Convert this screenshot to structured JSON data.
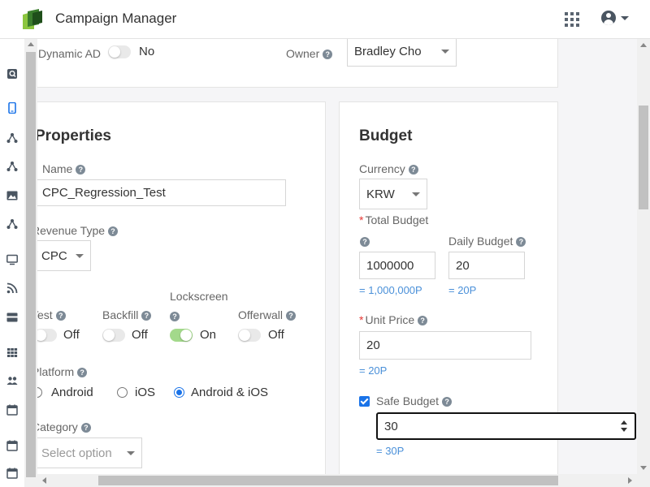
{
  "app": {
    "title": "Campaign Manager"
  },
  "top_card": {
    "dynamic_ad_label": "Dynamic AD",
    "dynamic_ad_value": "No",
    "owner_label": "Owner",
    "owner_value": "Bradley Cho"
  },
  "properties": {
    "heading": "Properties",
    "name_label": "Name",
    "name_value": "CPC_Regression_Test",
    "revenue_type_label": "Revenue Type",
    "revenue_type_value": "CPC",
    "toggles": [
      {
        "label": "Test",
        "state": "Off",
        "on": false
      },
      {
        "label": "Backfill",
        "state": "Off",
        "on": false
      },
      {
        "label": "Lockscreen",
        "state": "On",
        "on": true
      },
      {
        "label": "Offerwall",
        "state": "Off",
        "on": false
      }
    ],
    "platform_label": "Platform",
    "platform_options": [
      "Android",
      "iOS",
      "Android & iOS"
    ],
    "platform_selected": "Android & iOS",
    "category_label": "Category",
    "category_placeholder": "Select option"
  },
  "budget": {
    "heading": "Budget",
    "currency_label": "Currency",
    "currency_value": "KRW",
    "total_budget_label": "Total Budget",
    "total_budget_value": "1000000",
    "total_budget_hint": "= 1,000,000P",
    "daily_budget_label": "Daily Budget",
    "daily_budget_value": "20",
    "daily_budget_hint": "= 20P",
    "unit_price_label": "Unit Price",
    "unit_price_value": "20",
    "unit_price_hint": "= 20P",
    "safe_budget_label": "Safe Budget",
    "safe_budget_checked": true,
    "safe_budget_value": "30",
    "safe_budget_hint": "= 30P"
  },
  "rail_icons": [
    "search-doc-icon",
    "mobile-icon",
    "hierarchy-icon",
    "hierarchy-icon",
    "image-icon",
    "hierarchy-icon",
    "monitor-icon",
    "rss-icon",
    "card-icon",
    "grid-icon",
    "people-icon",
    "calendar-icon",
    "calendar-icon",
    "calendar-icon"
  ],
  "colors": {
    "accent": "#1a73e8",
    "toggle_on": "#a3d98b",
    "hint": "#4a90d9",
    "required": "#e53935"
  }
}
